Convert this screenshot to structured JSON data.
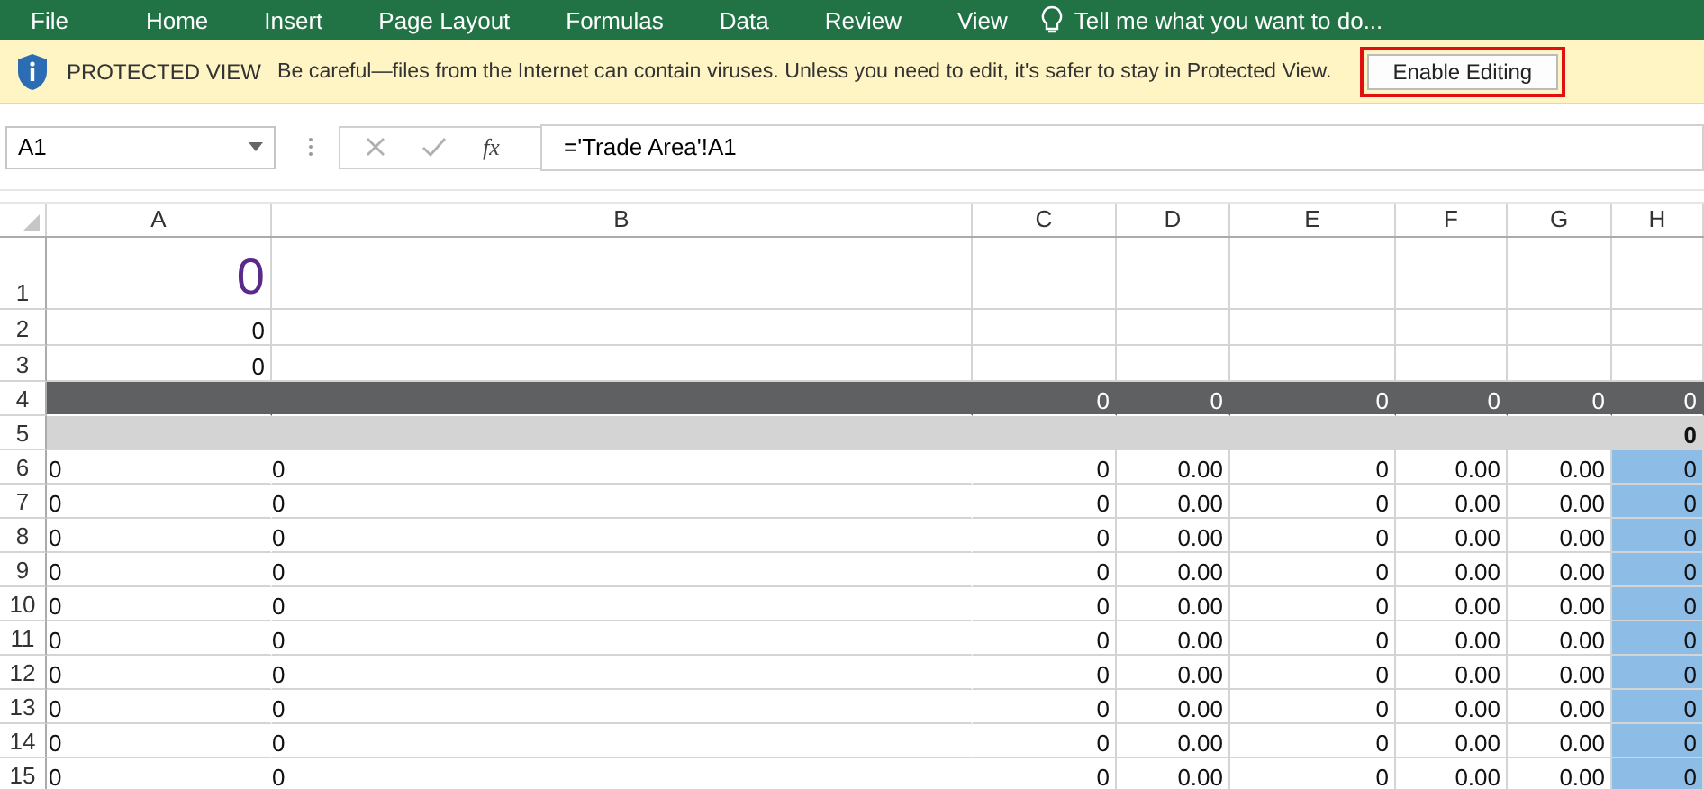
{
  "ribbon_tabs": [
    "File",
    "Home",
    "Insert",
    "Page Layout",
    "Formulas",
    "Data",
    "Review",
    "View"
  ],
  "tell_me": {
    "placeholder": "Tell me what you want to do..."
  },
  "protected_view": {
    "title": "PROTECTED VIEW",
    "message": "Be careful—files from the Internet can contain viruses. Unless you need to edit, it's safer to stay in Protected View.",
    "button": "Enable Editing"
  },
  "name_box": {
    "value": "A1"
  },
  "formula_bar": {
    "function_label": "fx",
    "value": "='Trade Area'!A1"
  },
  "columns": [
    "A",
    "B",
    "C",
    "D",
    "E",
    "F",
    "G",
    "H"
  ],
  "rows": [
    {
      "number": "1",
      "kind": "title",
      "cells": {
        "A": "0"
      }
    },
    {
      "number": "2",
      "kind": "plain",
      "cells": {
        "A": "0"
      }
    },
    {
      "number": "3",
      "kind": "plain",
      "cells": {
        "A": "0"
      }
    },
    {
      "number": "4",
      "kind": "dark",
      "cells": {
        "C": "0",
        "D": "0",
        "E": "0",
        "F": "0",
        "G": "0",
        "H": "0"
      }
    },
    {
      "number": "5",
      "kind": "light",
      "cells": {
        "H": "0"
      }
    },
    {
      "number": "6",
      "kind": "data",
      "cells": {
        "A": "0",
        "B": "0",
        "C": "0",
        "D": "0.00",
        "E": "0",
        "F": "0.00",
        "G": "0.00",
        "H": "0"
      }
    },
    {
      "number": "7",
      "kind": "data",
      "cells": {
        "A": "0",
        "B": "0",
        "C": "0",
        "D": "0.00",
        "E": "0",
        "F": "0.00",
        "G": "0.00",
        "H": "0"
      }
    },
    {
      "number": "8",
      "kind": "data",
      "cells": {
        "A": "0",
        "B": "0",
        "C": "0",
        "D": "0.00",
        "E": "0",
        "F": "0.00",
        "G": "0.00",
        "H": "0"
      }
    },
    {
      "number": "9",
      "kind": "data",
      "cells": {
        "A": "0",
        "B": "0",
        "C": "0",
        "D": "0.00",
        "E": "0",
        "F": "0.00",
        "G": "0.00",
        "H": "0"
      }
    },
    {
      "number": "10",
      "kind": "data",
      "cells": {
        "A": "0",
        "B": "0",
        "C": "0",
        "D": "0.00",
        "E": "0",
        "F": "0.00",
        "G": "0.00",
        "H": "0"
      }
    },
    {
      "number": "11",
      "kind": "data",
      "cells": {
        "A": "0",
        "B": "0",
        "C": "0",
        "D": "0.00",
        "E": "0",
        "F": "0.00",
        "G": "0.00",
        "H": "0"
      }
    },
    {
      "number": "12",
      "kind": "data",
      "cells": {
        "A": "0",
        "B": "0",
        "C": "0",
        "D": "0.00",
        "E": "0",
        "F": "0.00",
        "G": "0.00",
        "H": "0"
      }
    },
    {
      "number": "13",
      "kind": "data",
      "cells": {
        "A": "0",
        "B": "0",
        "C": "0",
        "D": "0.00",
        "E": "0",
        "F": "0.00",
        "G": "0.00",
        "H": "0"
      }
    },
    {
      "number": "14",
      "kind": "data",
      "cells": {
        "A": "0",
        "B": "0",
        "C": "0",
        "D": "0.00",
        "E": "0",
        "F": "0.00",
        "G": "0.00",
        "H": "0"
      }
    },
    {
      "number": "15",
      "kind": "data",
      "cells": {
        "A": "0",
        "B": "0",
        "C": "0",
        "D": "0.00",
        "E": "0",
        "F": "0.00",
        "G": "0.00",
        "H": "0"
      }
    }
  ]
}
